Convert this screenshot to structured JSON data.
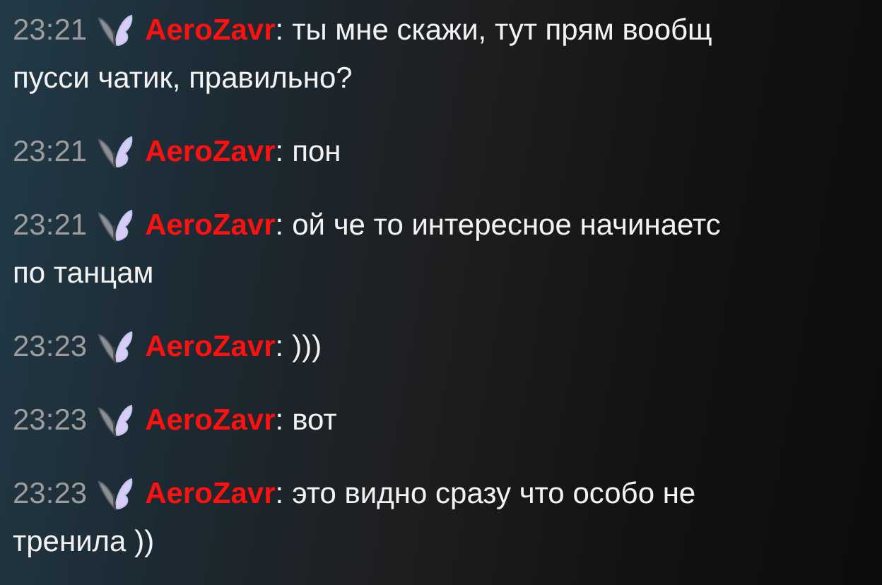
{
  "separator": ":",
  "messages": [
    {
      "time": "23:21",
      "user": "AeroZavr",
      "lines": [
        "ты мне скажи, тут прям вообщ",
        "пусси чатик, правильно?"
      ]
    },
    {
      "time": "23:21",
      "user": "AeroZavr",
      "lines": [
        "пон"
      ]
    },
    {
      "time": "23:21",
      "user": "AeroZavr",
      "lines": [
        "ой че то интересное начинаетс",
        "по танцам"
      ]
    },
    {
      "time": "23:23",
      "user": "AeroZavr",
      "lines": [
        ")))"
      ]
    },
    {
      "time": "23:23",
      "user": "AeroZavr",
      "lines": [
        "вот"
      ]
    },
    {
      "time": "23:23",
      "user": "AeroZavr",
      "lines": [
        "это видно сразу что особо не",
        "тренила ))"
      ]
    }
  ]
}
